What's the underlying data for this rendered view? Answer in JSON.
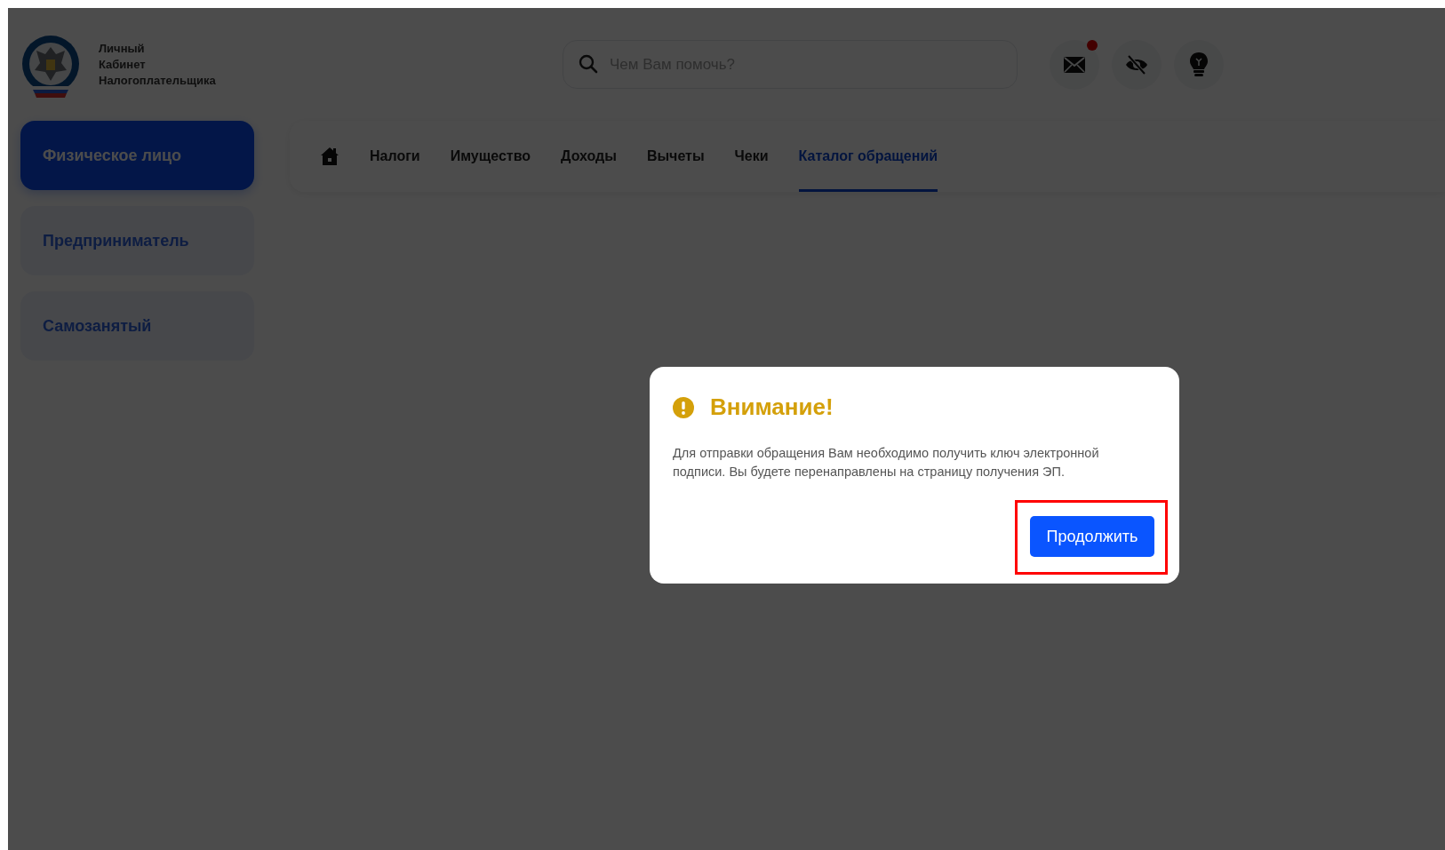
{
  "header": {
    "logo_lines": [
      "Личный",
      "Кабинет",
      "Налогоплательщика"
    ],
    "search": {
      "placeholder": "Чем Вам помочь?"
    },
    "actions": [
      {
        "kind": "mail",
        "badge": true
      },
      {
        "kind": "visibility",
        "badge": false
      },
      {
        "kind": "hint",
        "badge": false
      }
    ]
  },
  "sidebar": {
    "items": [
      {
        "label": "Физическое лицо",
        "selected": true
      },
      {
        "label": "Предприниматель",
        "selected": false
      },
      {
        "label": "Самозанятый",
        "selected": false
      }
    ]
  },
  "nav": {
    "tabs": [
      {
        "kind": "home",
        "selected": false
      },
      {
        "kind": "text",
        "label": "Налоги",
        "selected": false
      },
      {
        "kind": "text",
        "label": "Имущество",
        "selected": false
      },
      {
        "kind": "text",
        "label": "Доходы",
        "selected": false
      },
      {
        "kind": "text",
        "label": "Вычеты",
        "selected": false
      },
      {
        "kind": "text",
        "label": "Чеки",
        "selected": false
      },
      {
        "kind": "text",
        "label": "Каталог обращений",
        "selected": true
      }
    ]
  },
  "dialog": {
    "title": "Внимание!",
    "message": "Для отправки обращения Вам необходимо получить ключ электронной подписи. Вы будете перенаправлены на страницу получения ЭП.",
    "button": {
      "label": "Продолжить",
      "highlighted": true
    }
  }
}
